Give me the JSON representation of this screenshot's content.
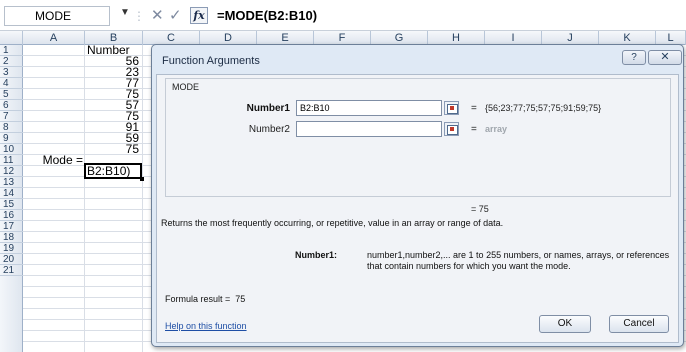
{
  "formula_bar": {
    "name_box": "MODE",
    "cancel_symbol": "✕",
    "enter_symbol": "✓",
    "fx_label": "fx",
    "formula": "=MODE(B2:B10)"
  },
  "columns": [
    "A",
    "B",
    "C",
    "D",
    "E",
    "F",
    "G",
    "H",
    "I",
    "J",
    "K",
    "L"
  ],
  "rows": [
    "1",
    "2",
    "3",
    "4",
    "5",
    "6",
    "7",
    "8",
    "9",
    "10",
    "11",
    "12",
    "13",
    "14",
    "15",
    "16",
    "17",
    "18",
    "19",
    "20",
    "21"
  ],
  "cells": {
    "b1": "Number",
    "values": [
      "56",
      "23",
      "77",
      "75",
      "57",
      "75",
      "91",
      "59",
      "75"
    ],
    "a11": "Mode =",
    "b11": "B2:B10)"
  },
  "dialog": {
    "title": "Function Arguments",
    "help_label": "?",
    "close_label": "✕",
    "group_label": "MODE",
    "arg1_label": "Number1",
    "arg1_value": "B2:B10",
    "arg1_eq": "=",
    "arg1_result": "{56;23;77;75;57;75;91;59;75}",
    "arg2_label": "Number2",
    "arg2_value": "",
    "arg2_eq": "=",
    "arg2_result": "array",
    "total_result": "= 75",
    "description": "Returns the most frequently occurring, or repetitive, value in an array or range of data.",
    "arg_desc_name": "Number1:",
    "arg_desc_text": "number1,number2,... are 1 to 255 numbers, or names, arrays, or references that contain numbers for which you want the mode.",
    "formula_result_label": "Formula result =",
    "formula_result_value": "75",
    "help_link": "Help on this function",
    "ok_label": "OK",
    "cancel_label": "Cancel"
  },
  "colors": {
    "dialog_bg": "#dfe9f5",
    "link": "#1e4ea5",
    "grid_line": "#d9dee6"
  }
}
